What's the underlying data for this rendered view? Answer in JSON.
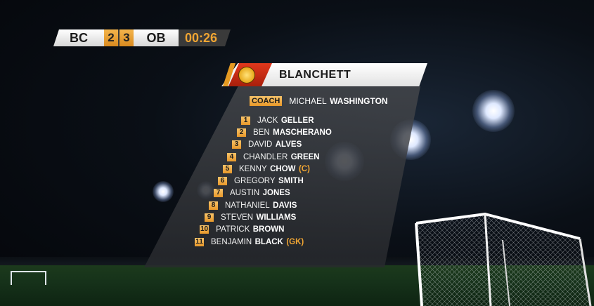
{
  "scoreboard": {
    "home": "BC",
    "home_score": "2",
    "away_score": "3",
    "away": "OB",
    "clock": "00:26"
  },
  "lineup": {
    "team_name": "BLANCHETT",
    "coach_label": "COACH",
    "coach_first": "MICHAEL",
    "coach_last": "WASHINGTON",
    "players": [
      {
        "number": "1",
        "first": "JACK",
        "last": "GELLER",
        "role": ""
      },
      {
        "number": "2",
        "first": "BEN",
        "last": "MASCHERANO",
        "role": ""
      },
      {
        "number": "3",
        "first": "DAVID",
        "last": "ALVES",
        "role": ""
      },
      {
        "number": "4",
        "first": "CHANDLER",
        "last": "GREEN",
        "role": ""
      },
      {
        "number": "5",
        "first": "KENNY",
        "last": "CHOW",
        "role": "(C)"
      },
      {
        "number": "6",
        "first": "GREGORY",
        "last": "SMITH",
        "role": ""
      },
      {
        "number": "7",
        "first": "AUSTIN",
        "last": "JONES",
        "role": ""
      },
      {
        "number": "8",
        "first": "NATHANIEL",
        "last": "DAVIS",
        "role": ""
      },
      {
        "number": "9",
        "first": "STEVEN",
        "last": "WILLIAMS",
        "role": ""
      },
      {
        "number": "10",
        "first": "PATRICK",
        "last": "BROWN",
        "role": ""
      },
      {
        "number": "11",
        "first": "BENJAMIN",
        "last": "BLACK",
        "role": "(GK)"
      }
    ]
  },
  "colors": {
    "accent": "#e8982a",
    "clock": "#f0a533",
    "crest_red": "#c82a14"
  }
}
